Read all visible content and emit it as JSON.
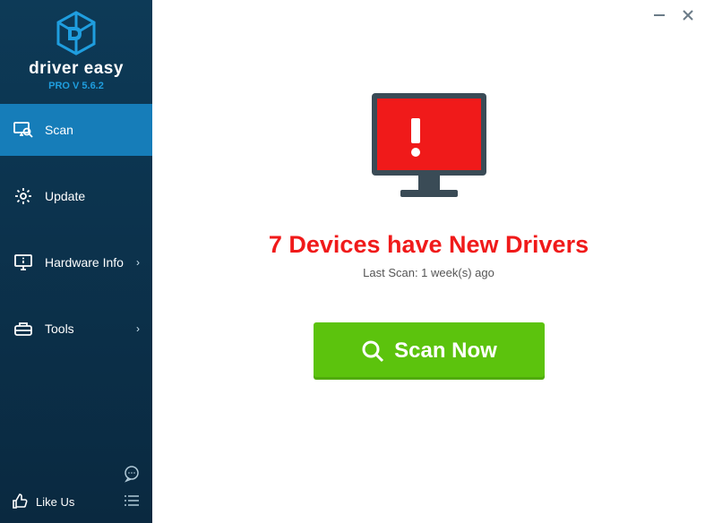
{
  "brand": {
    "name": "driver easy",
    "version": "PRO V 5.6.2"
  },
  "sidebar": {
    "items": [
      {
        "label": "Scan",
        "chev": ""
      },
      {
        "label": "Update",
        "chev": ""
      },
      {
        "label": "Hardware Info",
        "chev": "›"
      },
      {
        "label": "Tools",
        "chev": "›"
      }
    ],
    "like_label": "Like Us"
  },
  "main": {
    "headline": "7 Devices have New Drivers",
    "subline": "Last Scan: 1 week(s) ago",
    "scan_button": "Scan Now"
  }
}
